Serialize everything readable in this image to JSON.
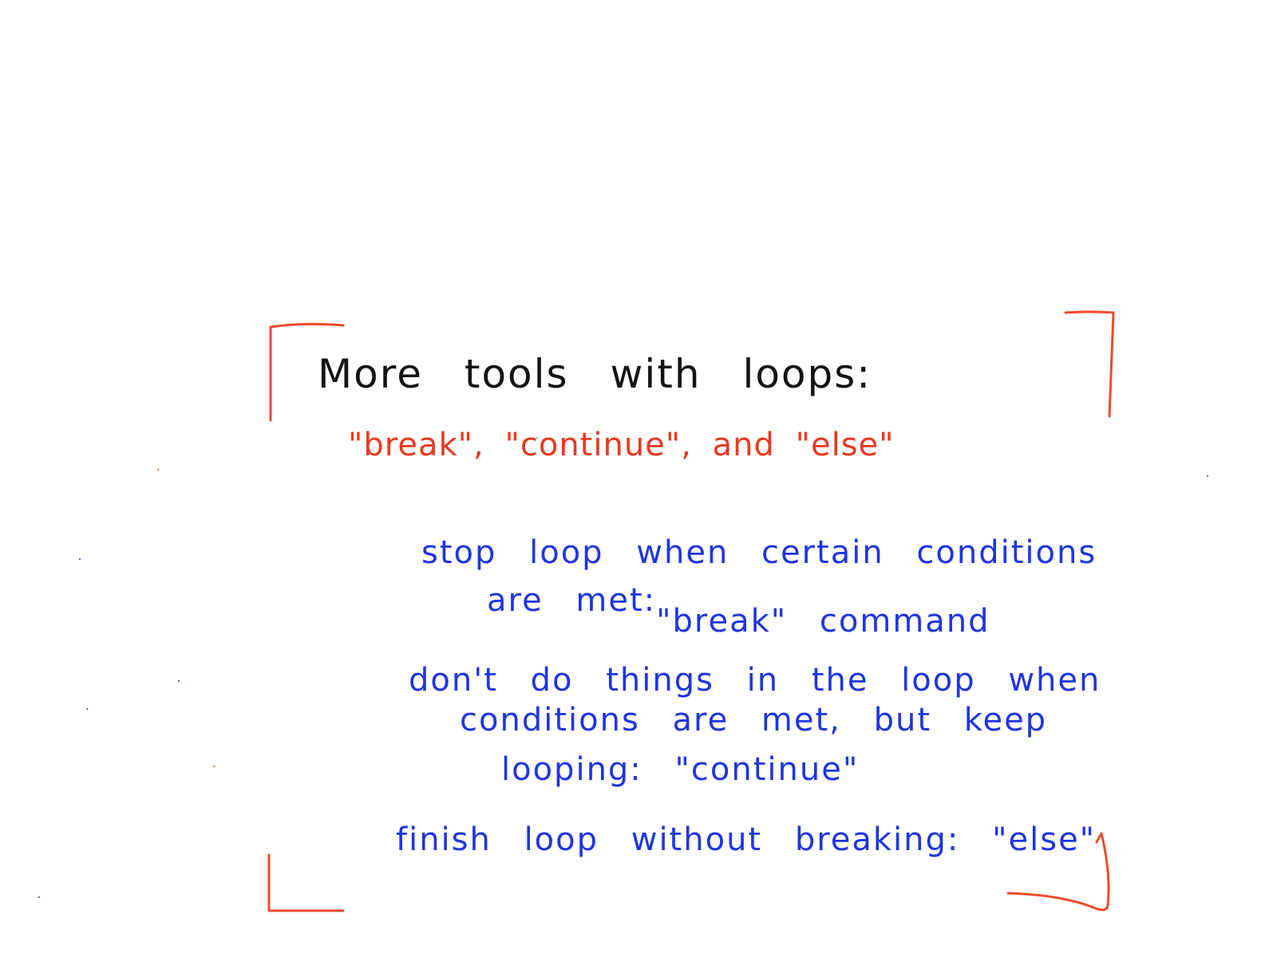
{
  "title": "More tools with loops:",
  "subtitle": "\"break\", \"continue\", and \"else\"",
  "notes": {
    "break_line1": "stop loop when certain conditions",
    "break_line2_prefix": "are met:",
    "break_line2_keyword": "\"break\" command",
    "continue_line1": "don't do things in the loop when",
    "continue_line2": "conditions are met, but keep",
    "continue_line3": "looping: \"continue\"",
    "else_line": "finish loop without breaking: \"else\""
  },
  "colors": {
    "title": "#141414",
    "subtitle": "#e8391f",
    "notes": "#1f35e0",
    "brackets": "#ee4a2d",
    "specks": "#2a3cc8"
  }
}
